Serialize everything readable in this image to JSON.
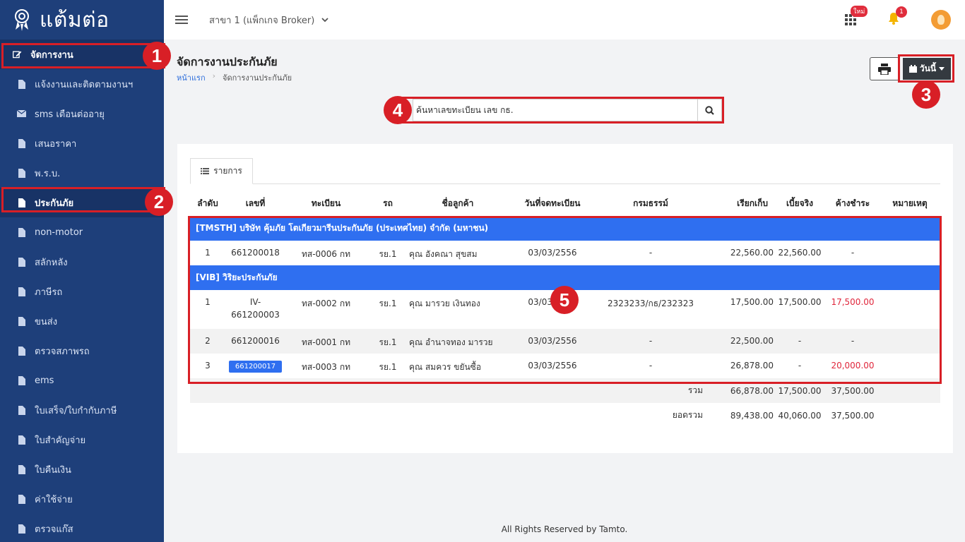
{
  "brand": {
    "name": "แต้มต่อ"
  },
  "sidebar": {
    "items": [
      {
        "label": "จัดการงาน",
        "icon": "edit-icon"
      },
      {
        "label": "แจ้งงานและติดตามงานฯ",
        "icon": "file-icon"
      },
      {
        "label": "sms เตือนต่ออายุ",
        "icon": "envelope-icon"
      },
      {
        "label": "เสนอราคา",
        "icon": "file-icon"
      },
      {
        "label": "พ.ร.บ.",
        "icon": "file-icon"
      },
      {
        "label": "ประกันภัย",
        "icon": "file-icon"
      },
      {
        "label": "non-motor",
        "icon": "file-icon"
      },
      {
        "label": "สลักหลัง",
        "icon": "file-icon"
      },
      {
        "label": "ภาษีรถ",
        "icon": "file-icon"
      },
      {
        "label": "ขนส่ง",
        "icon": "file-icon"
      },
      {
        "label": "ตรวจสภาพรถ",
        "icon": "file-icon"
      },
      {
        "label": "ems",
        "icon": "file-icon"
      },
      {
        "label": "ใบเสร็จ/ใบกำกับภาษี",
        "icon": "file-icon"
      },
      {
        "label": "ใบสำคัญจ่าย",
        "icon": "file-icon"
      },
      {
        "label": "ใบคืนเงิน",
        "icon": "file-icon"
      },
      {
        "label": "ค่าใช้จ่าย",
        "icon": "file-icon"
      },
      {
        "label": "ตรวจแก๊ส",
        "icon": "file-icon"
      }
    ]
  },
  "topbar": {
    "branch": "สาขา 1 (แพ็กเกจ Broker)",
    "apps_badge": "ใหม่",
    "notif_count": "1"
  },
  "page": {
    "title": "จัดการงานประกันภัย",
    "breadcrumb_home": "หน้าแรก",
    "breadcrumb_current": "จัดการงานประกันภัย",
    "date_button": "วันนี้"
  },
  "search": {
    "placeholder": "ค้นหาเลขทะเบียน เลข กธ."
  },
  "annotations": [
    "1",
    "2",
    "3",
    "4",
    "5"
  ],
  "tab": {
    "label": "รายการ"
  },
  "table": {
    "headers": [
      "ลำดับ",
      "เลขที่",
      "ทะเบียน",
      "รถ",
      "ชื่อลูกค้า",
      "วันที่จดทะเบียน",
      "กรมธรรม์",
      "เรียกเก็บ",
      "เบี้ยจริง",
      "ค้างชำระ",
      "หมายเหตุ"
    ],
    "groups": [
      {
        "title": "[TMSTH] บริษัท คุ้มภัย โตเกียวมารีนประกันภัย (ประเทศไทย) จำกัด (มหาชน)",
        "rows": [
          {
            "no": "1",
            "doc": "661200018",
            "plate": "ทส-0006 กท",
            "car": "รย.1",
            "customer": "คุณ อังคณา สุขสม",
            "date": "03/03/2556",
            "policy": "-",
            "charge": "22,560.00",
            "premium": "22,560.00",
            "due": "-",
            "note": ""
          }
        ]
      },
      {
        "title": "[VIB] วิริยะประกันภัย",
        "rows": [
          {
            "no": "1",
            "doc_line1": "IV-",
            "doc_line2": "661200003",
            "plate": "ทส-0002 กท",
            "car": "รย.1",
            "customer": "คุณ มารวย เงินทอง",
            "date": "03/03/2556",
            "policy": "2323233/กธ/232323",
            "charge": "17,500.00",
            "premium": "17,500.00",
            "due": "17,500.00",
            "note": ""
          },
          {
            "no": "2",
            "doc": "661200016",
            "plate": "ทส-0001 กท",
            "car": "รย.1",
            "customer": "คุณ อำนาจทอง มารวย",
            "date": "03/03/2556",
            "policy": "-",
            "charge": "22,500.00",
            "premium": "-",
            "due": "-",
            "note": ""
          },
          {
            "no": "3",
            "doc": "661200017",
            "plate": "ทส-0003 กท",
            "car": "รย.1",
            "customer": "คุณ สมควร ขยันซื้อ",
            "date": "03/03/2556",
            "policy": "-",
            "charge": "26,878.00",
            "premium": "-",
            "due": "20,000.00",
            "note": ""
          }
        ]
      }
    ],
    "sum": {
      "label": "รวม",
      "charge": "66,878.00",
      "premium": "17,500.00",
      "due": "37,500.00"
    },
    "total": {
      "label": "ยอดรวม",
      "charge": "89,438.00",
      "premium": "40,060.00",
      "due": "37,500.00"
    }
  },
  "footer": {
    "text": "All Rights Reserved by Tamto."
  },
  "colors": {
    "sidebar": "#1e3f7a",
    "group_row": "#2f6ff0",
    "annotation": "#d81f26",
    "overdue": "#e0263b"
  }
}
